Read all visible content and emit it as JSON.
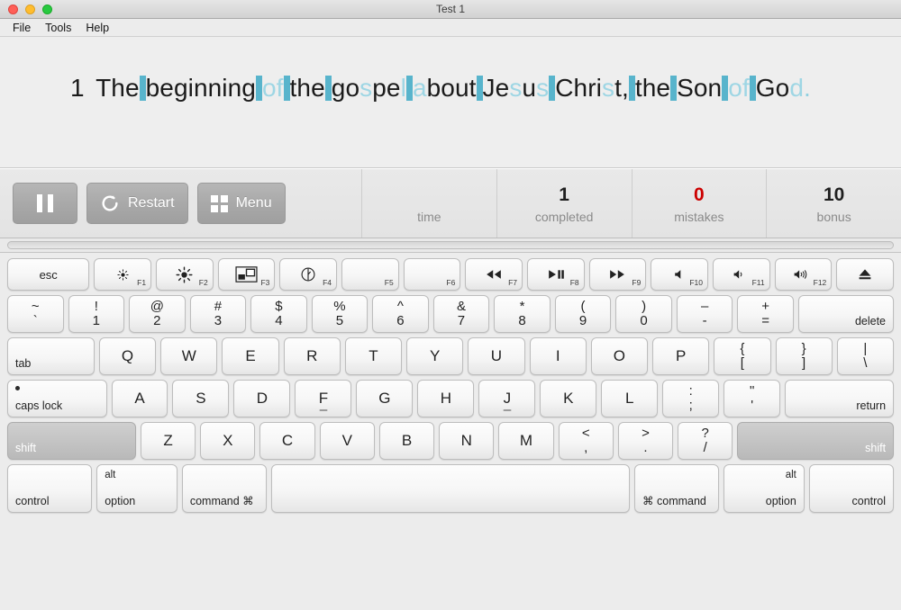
{
  "window": {
    "title": "Test 1",
    "traffic_lights": [
      "close-button",
      "minimize-button",
      "maximize-button"
    ]
  },
  "menubar": {
    "items": [
      {
        "label": "File"
      },
      {
        "label": "Tools"
      },
      {
        "label": "Help"
      }
    ]
  },
  "passage": {
    "verse_number": "1",
    "text": "The beginning of the gospel about Jesus Christ, the Son of God.",
    "tokens": [
      {
        "t": "num",
        "v": "1"
      },
      {
        "t": "plain",
        "v": " "
      },
      {
        "t": "plain",
        "v": "The"
      },
      {
        "t": "space",
        "v": " "
      },
      {
        "t": "plain",
        "v": "beginning"
      },
      {
        "t": "space",
        "v": " "
      },
      {
        "t": "hl",
        "v": "of"
      },
      {
        "t": "space",
        "v": " "
      },
      {
        "t": "plain",
        "v": "the"
      },
      {
        "t": "space",
        "v": " "
      },
      {
        "t": "plain",
        "v": "go"
      },
      {
        "t": "hl",
        "v": "s"
      },
      {
        "t": "plain",
        "v": "pe"
      },
      {
        "t": "hl",
        "v": "l"
      },
      {
        "t": "space",
        "v": " "
      },
      {
        "t": "hl",
        "v": "a"
      },
      {
        "t": "plain",
        "v": "bout"
      },
      {
        "t": "space",
        "v": " "
      },
      {
        "t": "plain",
        "v": "Je"
      },
      {
        "t": "hl",
        "v": "s"
      },
      {
        "t": "plain",
        "v": "u"
      },
      {
        "t": "hl",
        "v": "s"
      },
      {
        "t": "space",
        "v": " "
      },
      {
        "t": "plain",
        "v": "Chri"
      },
      {
        "t": "hl",
        "v": "s"
      },
      {
        "t": "plain",
        "v": "t,"
      },
      {
        "t": "space",
        "v": " "
      },
      {
        "t": "plain",
        "v": "the"
      },
      {
        "t": "space",
        "v": " "
      },
      {
        "t": "plain",
        "v": "Son"
      },
      {
        "t": "space",
        "v": " "
      },
      {
        "t": "hl",
        "v": "of"
      },
      {
        "t": "space",
        "v": " "
      },
      {
        "t": "plain",
        "v": "Go"
      },
      {
        "t": "hl",
        "v": "d"
      },
      {
        "t": "dot",
        "v": "."
      }
    ]
  },
  "controls": {
    "pause_label": "",
    "restart_label": "Restart",
    "menu_label": "Menu"
  },
  "stats": [
    {
      "value": "",
      "label": "time",
      "accent": "#8a8a8a"
    },
    {
      "value": "1",
      "label": "completed",
      "accent": "#1f1f1f"
    },
    {
      "value": "0",
      "label": "mistakes",
      "accent": "#cc0000"
    },
    {
      "value": "10",
      "label": "bonus",
      "accent": "#1f1f1f"
    }
  ],
  "progress": {
    "percent": 0
  },
  "colors": {
    "space_highlight": "#58b4cc",
    "char_highlight": "#9ed6e4",
    "mistakes_red": "#cc0000",
    "key_active": "#c4c4c4"
  },
  "keyboard": {
    "rows": {
      "fn": [
        {
          "name": "key-esc",
          "main": "esc",
          "style": "text",
          "flex": 1.45
        },
        {
          "name": "key-f1",
          "icon": "brightness-down-icon",
          "fnum": "F1",
          "flex": 1
        },
        {
          "name": "key-f2",
          "icon": "brightness-up-icon",
          "fnum": "F2",
          "flex": 1
        },
        {
          "name": "key-f3",
          "icon": "mission-control-icon",
          "fnum": "F3",
          "flex": 1
        },
        {
          "name": "key-f4",
          "icon": "dashboard-icon",
          "fnum": "F4",
          "flex": 1
        },
        {
          "name": "key-f5",
          "icon": "",
          "fnum": "F5",
          "flex": 1
        },
        {
          "name": "key-f6",
          "icon": "",
          "fnum": "F6",
          "flex": 1
        },
        {
          "name": "key-f7",
          "icon": "rewind-icon",
          "fnum": "F7",
          "flex": 1
        },
        {
          "name": "key-f8",
          "icon": "play-pause-icon",
          "fnum": "F8",
          "flex": 1
        },
        {
          "name": "key-f9",
          "icon": "fast-forward-icon",
          "fnum": "F9",
          "flex": 1
        },
        {
          "name": "key-f10",
          "icon": "mute-icon",
          "fnum": "F10",
          "flex": 1
        },
        {
          "name": "key-f11",
          "icon": "volume-down-icon",
          "fnum": "F11",
          "flex": 1
        },
        {
          "name": "key-f12",
          "icon": "volume-up-icon",
          "fnum": "F12",
          "flex": 1
        },
        {
          "name": "key-eject",
          "icon": "eject-icon",
          "fnum": "",
          "flex": 1
        }
      ],
      "numbers": [
        {
          "name": "key-backtick",
          "top": "~",
          "bot": "`",
          "flex": 1
        },
        {
          "name": "key-1",
          "top": "!",
          "bot": "1",
          "flex": 1
        },
        {
          "name": "key-2",
          "top": "@",
          "bot": "2",
          "flex": 1
        },
        {
          "name": "key-3",
          "top": "#",
          "bot": "3",
          "flex": 1
        },
        {
          "name": "key-4",
          "top": "$",
          "bot": "4",
          "flex": 1
        },
        {
          "name": "key-5",
          "top": "%",
          "bot": "5",
          "flex": 1
        },
        {
          "name": "key-6",
          "top": "^",
          "bot": "6",
          "flex": 1
        },
        {
          "name": "key-7",
          "top": "&",
          "bot": "7",
          "flex": 1
        },
        {
          "name": "key-8",
          "top": "*",
          "bot": "8",
          "flex": 1
        },
        {
          "name": "key-9",
          "top": "(",
          "bot": "9",
          "flex": 1
        },
        {
          "name": "key-0",
          "top": ")",
          "bot": "0",
          "flex": 1
        },
        {
          "name": "key-minus",
          "top": "–",
          "bot": "-",
          "flex": 1
        },
        {
          "name": "key-equals",
          "top": "+",
          "bot": "=",
          "flex": 1
        },
        {
          "name": "key-delete",
          "main": "delete",
          "pos": "br",
          "flex": 1.72
        }
      ],
      "qwerty": [
        {
          "name": "key-tab",
          "main": "tab",
          "pos": "bl",
          "flex": 1.55
        },
        {
          "name": "key-q",
          "main": "Q",
          "flex": 1
        },
        {
          "name": "key-w",
          "main": "W",
          "flex": 1
        },
        {
          "name": "key-e",
          "main": "E",
          "flex": 1
        },
        {
          "name": "key-r",
          "main": "R",
          "flex": 1
        },
        {
          "name": "key-t",
          "main": "T",
          "flex": 1
        },
        {
          "name": "key-y",
          "main": "Y",
          "flex": 1
        },
        {
          "name": "key-u",
          "main": "U",
          "flex": 1
        },
        {
          "name": "key-i",
          "main": "I",
          "flex": 1
        },
        {
          "name": "key-o",
          "main": "O",
          "flex": 1
        },
        {
          "name": "key-p",
          "main": "P",
          "flex": 1
        },
        {
          "name": "key-leftbracket",
          "top": "{",
          "bot": "[",
          "flex": 1
        },
        {
          "name": "key-rightbracket",
          "top": "}",
          "bot": "]",
          "flex": 1
        },
        {
          "name": "key-backslash",
          "top": "|",
          "bot": "\\",
          "flex": 1
        }
      ],
      "home": [
        {
          "name": "key-capslock",
          "main": "caps lock",
          "pos": "bl",
          "led": true,
          "flex": 1.78
        },
        {
          "name": "key-a",
          "main": "A",
          "flex": 1
        },
        {
          "name": "key-s",
          "main": "S",
          "flex": 1
        },
        {
          "name": "key-d",
          "main": "D",
          "flex": 1
        },
        {
          "name": "key-f",
          "main": "F",
          "bump": true,
          "flex": 1
        },
        {
          "name": "key-g",
          "main": "G",
          "flex": 1
        },
        {
          "name": "key-h",
          "main": "H",
          "flex": 1
        },
        {
          "name": "key-j",
          "main": "J",
          "bump": true,
          "flex": 1
        },
        {
          "name": "key-k",
          "main": "K",
          "flex": 1
        },
        {
          "name": "key-l",
          "main": "L",
          "flex": 1
        },
        {
          "name": "key-semicolon",
          "top": ":",
          "bot": ";",
          "flex": 1
        },
        {
          "name": "key-quote",
          "top": "\"",
          "bot": "'",
          "flex": 1
        },
        {
          "name": "key-return",
          "main": "return",
          "pos": "br",
          "flex": 1.95
        }
      ],
      "shift": [
        {
          "name": "key-shift-left",
          "main": "shift",
          "pos": "bl",
          "active": true,
          "flex": 2.38
        },
        {
          "name": "key-z",
          "main": "Z",
          "flex": 1
        },
        {
          "name": "key-x",
          "main": "X",
          "flex": 1
        },
        {
          "name": "key-c",
          "main": "C",
          "flex": 1
        },
        {
          "name": "key-v",
          "main": "V",
          "flex": 1
        },
        {
          "name": "key-b",
          "main": "B",
          "flex": 1
        },
        {
          "name": "key-n",
          "main": "N",
          "flex": 1
        },
        {
          "name": "key-m",
          "main": "M",
          "flex": 1
        },
        {
          "name": "key-comma",
          "top": "<",
          "bot": ",",
          "flex": 1
        },
        {
          "name": "key-period",
          "top": ">",
          "bot": ".",
          "flex": 1
        },
        {
          "name": "key-slash",
          "top": "?",
          "bot": "/",
          "flex": 1
        },
        {
          "name": "key-shift-right",
          "main": "shift",
          "pos": "br",
          "active": true,
          "flex": 2.9
        }
      ],
      "bottom": [
        {
          "name": "key-control-left",
          "main": "control",
          "pos": "bl",
          "flex": 1.42
        },
        {
          "name": "key-option-left",
          "main": "option",
          "alt": "alt",
          "pos": "bl",
          "altpos": "tl",
          "flex": 1.35
        },
        {
          "name": "key-command-left",
          "main": "command ⌘",
          "pos": "bl",
          "flex": 1.42
        },
        {
          "name": "key-space",
          "main": "",
          "flex": 6.1
        },
        {
          "name": "key-command-right",
          "main": "⌘ command",
          "pos": "bl",
          "flex": 1.42
        },
        {
          "name": "key-option-right",
          "main": "option",
          "alt": "alt",
          "pos": "br",
          "altpos": "tr",
          "flex": 1.35
        },
        {
          "name": "key-control-right",
          "main": "control",
          "pos": "br",
          "flex": 1.42
        }
      ]
    }
  }
}
